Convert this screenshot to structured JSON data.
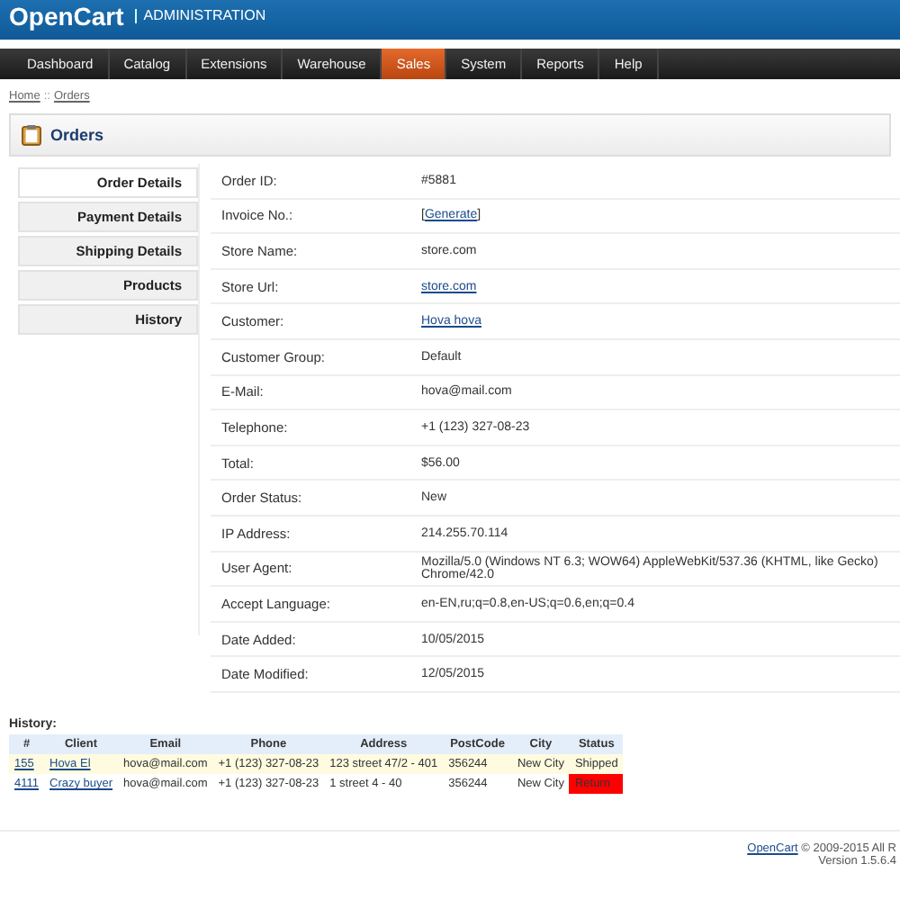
{
  "header": {
    "logo": "OpenCart",
    "subtitle": "ADMINISTRATION"
  },
  "menu": [
    {
      "label": "Dashboard",
      "selected": false
    },
    {
      "label": "Catalog",
      "selected": false
    },
    {
      "label": "Extensions",
      "selected": false
    },
    {
      "label": "Warehouse",
      "selected": false
    },
    {
      "label": "Sales",
      "selected": true
    },
    {
      "label": "System",
      "selected": false
    },
    {
      "label": "Reports",
      "selected": false
    },
    {
      "label": "Help",
      "selected": false
    }
  ],
  "breadcrumb": [
    "Home",
    "Orders"
  ],
  "breadcrumb_separator": "::",
  "panel_title": "Orders",
  "tabs": [
    {
      "label": "Order Details",
      "selected": true
    },
    {
      "label": "Payment Details",
      "selected": false
    },
    {
      "label": "Shipping Details",
      "selected": false
    },
    {
      "label": "Products",
      "selected": false
    },
    {
      "label": "History",
      "selected": false
    }
  ],
  "details": [
    {
      "label": "Order ID:",
      "kind": "text",
      "value": "#5881"
    },
    {
      "label": "Invoice No.:",
      "kind": "action",
      "open": "[",
      "value": "Generate",
      "close": "]"
    },
    {
      "label": "Store Name:",
      "kind": "text",
      "value": "store.com"
    },
    {
      "label": "Store Url:",
      "kind": "link",
      "value": "store.com"
    },
    {
      "label": "Customer:",
      "kind": "link",
      "value": "Hova hova"
    },
    {
      "label": "Customer Group:",
      "kind": "text",
      "value": "Default"
    },
    {
      "label": "E-Mail:",
      "kind": "text",
      "value": "hova@mail.com"
    },
    {
      "label": "Telephone:",
      "kind": "text",
      "value": "+1 (123) 327-08-23"
    },
    {
      "label": "Total:",
      "kind": "text",
      "value": "$56.00"
    },
    {
      "label": "Order Status:",
      "kind": "text",
      "value": "New"
    },
    {
      "label": "IP Address:",
      "kind": "text",
      "value": "214.255.70.114"
    },
    {
      "label": "User Agent:",
      "kind": "text",
      "value": "Mozilla/5.0 (Windows NT 6.3; WOW64) AppleWebKit/537.36 (KHTML, like Gecko) Chrome/42.0"
    },
    {
      "label": "Accept Language:",
      "kind": "text",
      "value": "en-EN,ru;q=0.8,en-US;q=0.6,en;q=0.4"
    },
    {
      "label": "Date Added:",
      "kind": "text",
      "value": "10/05/2015"
    },
    {
      "label": "Date Modified:",
      "kind": "text",
      "value": "12/05/2015"
    }
  ],
  "history": {
    "title": "History:",
    "columns": [
      "#",
      "Client",
      "Email",
      "Phone",
      "Address",
      "PostCode",
      "City",
      "Status"
    ],
    "rows": [
      {
        "id": "155",
        "client": "Hova El",
        "email": "hova@mail.com",
        "phone": "+1 (123) 327-08-23",
        "address": "123 street 47/2 - 401",
        "postcode": "356244",
        "city": "New City",
        "status": "Shipped",
        "highlighted": true
      },
      {
        "id": "4111",
        "client": "Crazy buyer",
        "email": "hova@mail.com",
        "phone": "+1 (123) 327-08-23",
        "address": "1 street 4 - 40",
        "postcode": "356244",
        "city": "New City",
        "status": "Return",
        "highlighted": false,
        "color": "#ff0000"
      }
    ]
  },
  "footer": {
    "link": "OpenCart",
    "text": "© 2009-2015 All R",
    "version": "Version 1.5.6.4"
  }
}
